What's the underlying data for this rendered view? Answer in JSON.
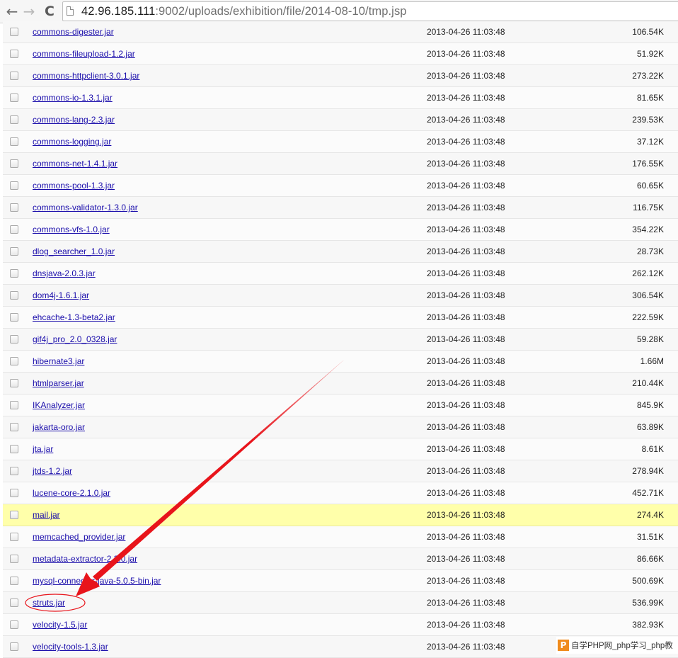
{
  "browser": {
    "back_glyph": "←",
    "forward_glyph": "→",
    "reload_glyph": "C",
    "url_host": "42.96.185.111",
    "url_rest": ":9002/uploads/exhibition/file/2014-08-10/tmp.jsp"
  },
  "highlight_color": "#ffffaa",
  "link_color": "#1a0dab",
  "annotation_color": "#e8141b",
  "files": [
    {
      "name": "commons-digester.jar",
      "date": "2013-04-26 11:03:48",
      "size": "106.54K"
    },
    {
      "name": "commons-fileupload-1.2.jar",
      "date": "2013-04-26 11:03:48",
      "size": "51.92K"
    },
    {
      "name": "commons-httpclient-3.0.1.jar",
      "date": "2013-04-26 11:03:48",
      "size": "273.22K"
    },
    {
      "name": "commons-io-1.3.1.jar",
      "date": "2013-04-26 11:03:48",
      "size": "81.65K"
    },
    {
      "name": "commons-lang-2.3.jar",
      "date": "2013-04-26 11:03:48",
      "size": "239.53K"
    },
    {
      "name": "commons-logging.jar",
      "date": "2013-04-26 11:03:48",
      "size": "37.12K"
    },
    {
      "name": "commons-net-1.4.1.jar",
      "date": "2013-04-26 11:03:48",
      "size": "176.55K"
    },
    {
      "name": "commons-pool-1.3.jar",
      "date": "2013-04-26 11:03:48",
      "size": "60.65K"
    },
    {
      "name": "commons-validator-1.3.0.jar",
      "date": "2013-04-26 11:03:48",
      "size": "116.75K"
    },
    {
      "name": "commons-vfs-1.0.jar",
      "date": "2013-04-26 11:03:48",
      "size": "354.22K"
    },
    {
      "name": "dlog_searcher_1.0.jar",
      "date": "2013-04-26 11:03:48",
      "size": "28.73K"
    },
    {
      "name": "dnsjava-2.0.3.jar",
      "date": "2013-04-26 11:03:48",
      "size": "262.12K"
    },
    {
      "name": "dom4j-1.6.1.jar",
      "date": "2013-04-26 11:03:48",
      "size": "306.54K"
    },
    {
      "name": "ehcache-1.3-beta2.jar",
      "date": "2013-04-26 11:03:48",
      "size": "222.59K"
    },
    {
      "name": "gif4j_pro_2.0_0328.jar",
      "date": "2013-04-26 11:03:48",
      "size": "59.28K"
    },
    {
      "name": "hibernate3.jar",
      "date": "2013-04-26 11:03:48",
      "size": "1.66M"
    },
    {
      "name": "htmlparser.jar",
      "date": "2013-04-26 11:03:48",
      "size": "210.44K"
    },
    {
      "name": "IKAnalyzer.jar",
      "date": "2013-04-26 11:03:48",
      "size": "845.9K"
    },
    {
      "name": "jakarta-oro.jar",
      "date": "2013-04-26 11:03:48",
      "size": "63.89K"
    },
    {
      "name": "jta.jar",
      "date": "2013-04-26 11:03:48",
      "size": "8.61K"
    },
    {
      "name": "jtds-1.2.jar",
      "date": "2013-04-26 11:03:48",
      "size": "278.94K"
    },
    {
      "name": "lucene-core-2.1.0.jar",
      "date": "2013-04-26 11:03:48",
      "size": "452.71K"
    },
    {
      "name": "mail.jar",
      "date": "2013-04-26 11:03:48",
      "size": "274.4K",
      "highlighted": true
    },
    {
      "name": "memcached_provider.jar",
      "date": "2013-04-26 11:03:48",
      "size": "31.51K"
    },
    {
      "name": "metadata-extractor-2.3.0.jar",
      "date": "2013-04-26 11:03:48",
      "size": "86.66K"
    },
    {
      "name": "mysql-connector-java-5.0.5-bin.jar",
      "date": "2013-04-26 11:03:48",
      "size": "500.69K"
    },
    {
      "name": "struts.jar",
      "date": "2013-04-26 11:03:48",
      "size": "536.99K",
      "annotated": true
    },
    {
      "name": "velocity-1.5.jar",
      "date": "2013-04-26 11:03:48",
      "size": "382.93K"
    },
    {
      "name": "velocity-tools-1.3.jar",
      "date": "2013-04-26 11:03:48",
      "size": "..."
    }
  ],
  "watermark": {
    "logo": "P",
    "text": "自学PHP网_php学习_php教"
  }
}
